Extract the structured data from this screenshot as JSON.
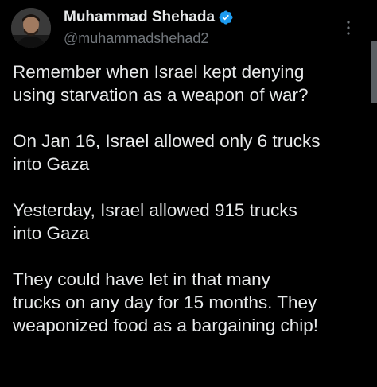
{
  "tweet": {
    "author": {
      "display_name": "Muhammad Shehada",
      "handle": "@muhammadshehad2",
      "verified": true,
      "verified_color": "#1d9bf0"
    },
    "icons": {
      "avatar": "avatar-photo",
      "verified": "verified-badge-icon",
      "more": "more-options-icon"
    },
    "paragraphs": [
      "Remember when Israel kept denying\nusing starvation as a weapon of war?",
      "On Jan 16, Israel allowed only 6 trucks\ninto Gaza",
      "Yesterday, Israel allowed 915 trucks\ninto Gaza",
      "They could have let in that many\ntrucks on any day for 15 months. They\nweaponized food as a bargaining chip!"
    ]
  },
  "colors": {
    "background": "#000000",
    "text": "#e7e9ea",
    "secondary_text": "#71767b"
  }
}
